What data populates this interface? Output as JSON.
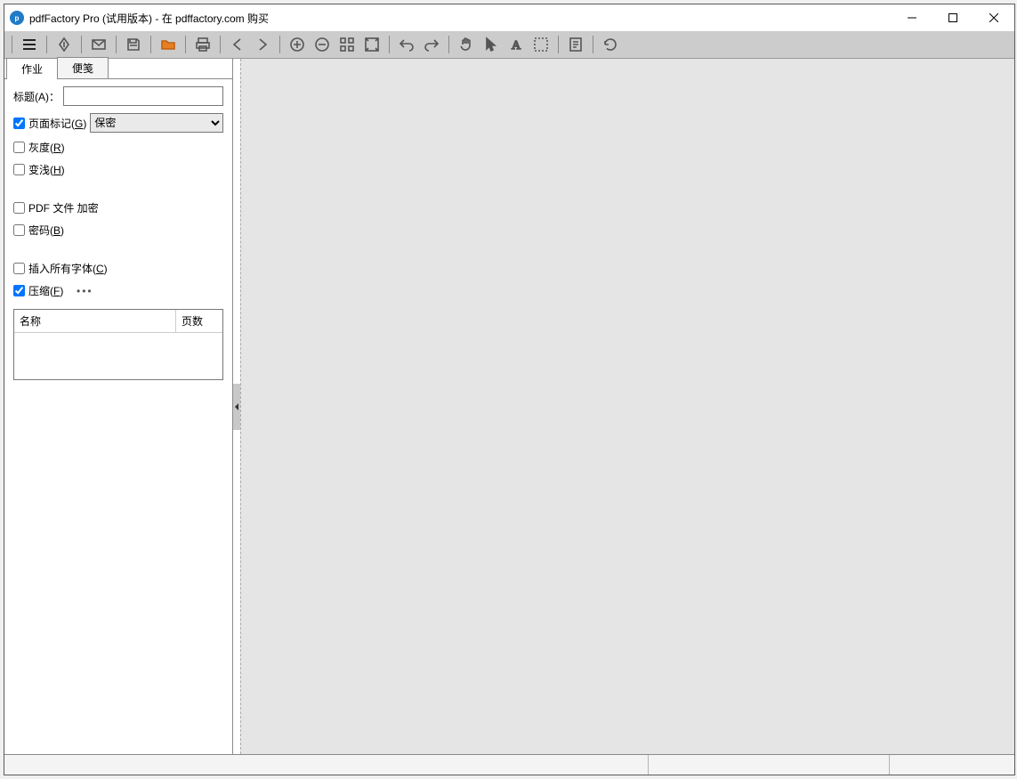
{
  "window": {
    "title": "pdfFactory Pro (试用版本) - 在 pdffactory.com 购买"
  },
  "tabs": {
    "job": "作业",
    "notes": "便笺"
  },
  "form": {
    "titleLabel": "标题(A)：",
    "titleValue": "",
    "pageMarkLabel": "页面标记(G)",
    "pageMarkChecked": true,
    "watermarkSelected": "保密",
    "grayLabel": "灰度(R)",
    "grayChecked": false,
    "lightLabel": "变浅(H)",
    "lightChecked": false,
    "encryptLabel": "PDF 文件 加密",
    "encryptChecked": false,
    "passwordLabel": "密码(B)",
    "passwordChecked": false,
    "embedFontsLabel": "插入所有字体(C)",
    "embedFontsChecked": false,
    "compressLabel": "压缩(F)",
    "compressChecked": true,
    "ellipsis": "•••"
  },
  "list": {
    "colName": "名称",
    "colPages": "页数"
  }
}
